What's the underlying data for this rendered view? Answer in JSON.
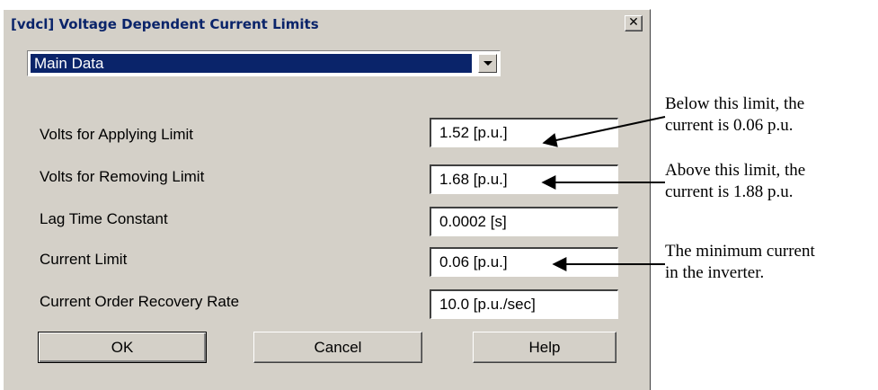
{
  "window": {
    "title": "[vdcl] Voltage Dependent Current Limits",
    "close_label": "✕"
  },
  "combo": {
    "selected": "Main Data"
  },
  "fields": [
    {
      "label": "Volts for Applying Limit",
      "value": "1.52 [p.u.]"
    },
    {
      "label": "Volts for Removing Limit",
      "value": "1.68 [p.u.]"
    },
    {
      "label": "Lag Time Constant",
      "value": "0.0002 [s]"
    },
    {
      "label": "Current Limit",
      "value": "0.06 [p.u.]"
    },
    {
      "label": "Current Order Recovery Rate",
      "value": "10.0 [p.u./sec]"
    }
  ],
  "buttons": {
    "ok": "OK",
    "cancel": "Cancel",
    "help": "Help"
  },
  "annotations": {
    "applying": "Below this limit, the\ncurrent is 0.06 p.u.",
    "removing": "Above this limit, the\ncurrent is 1.88 p.u.",
    "current_limit": "The minimum current\nin the inverter."
  }
}
